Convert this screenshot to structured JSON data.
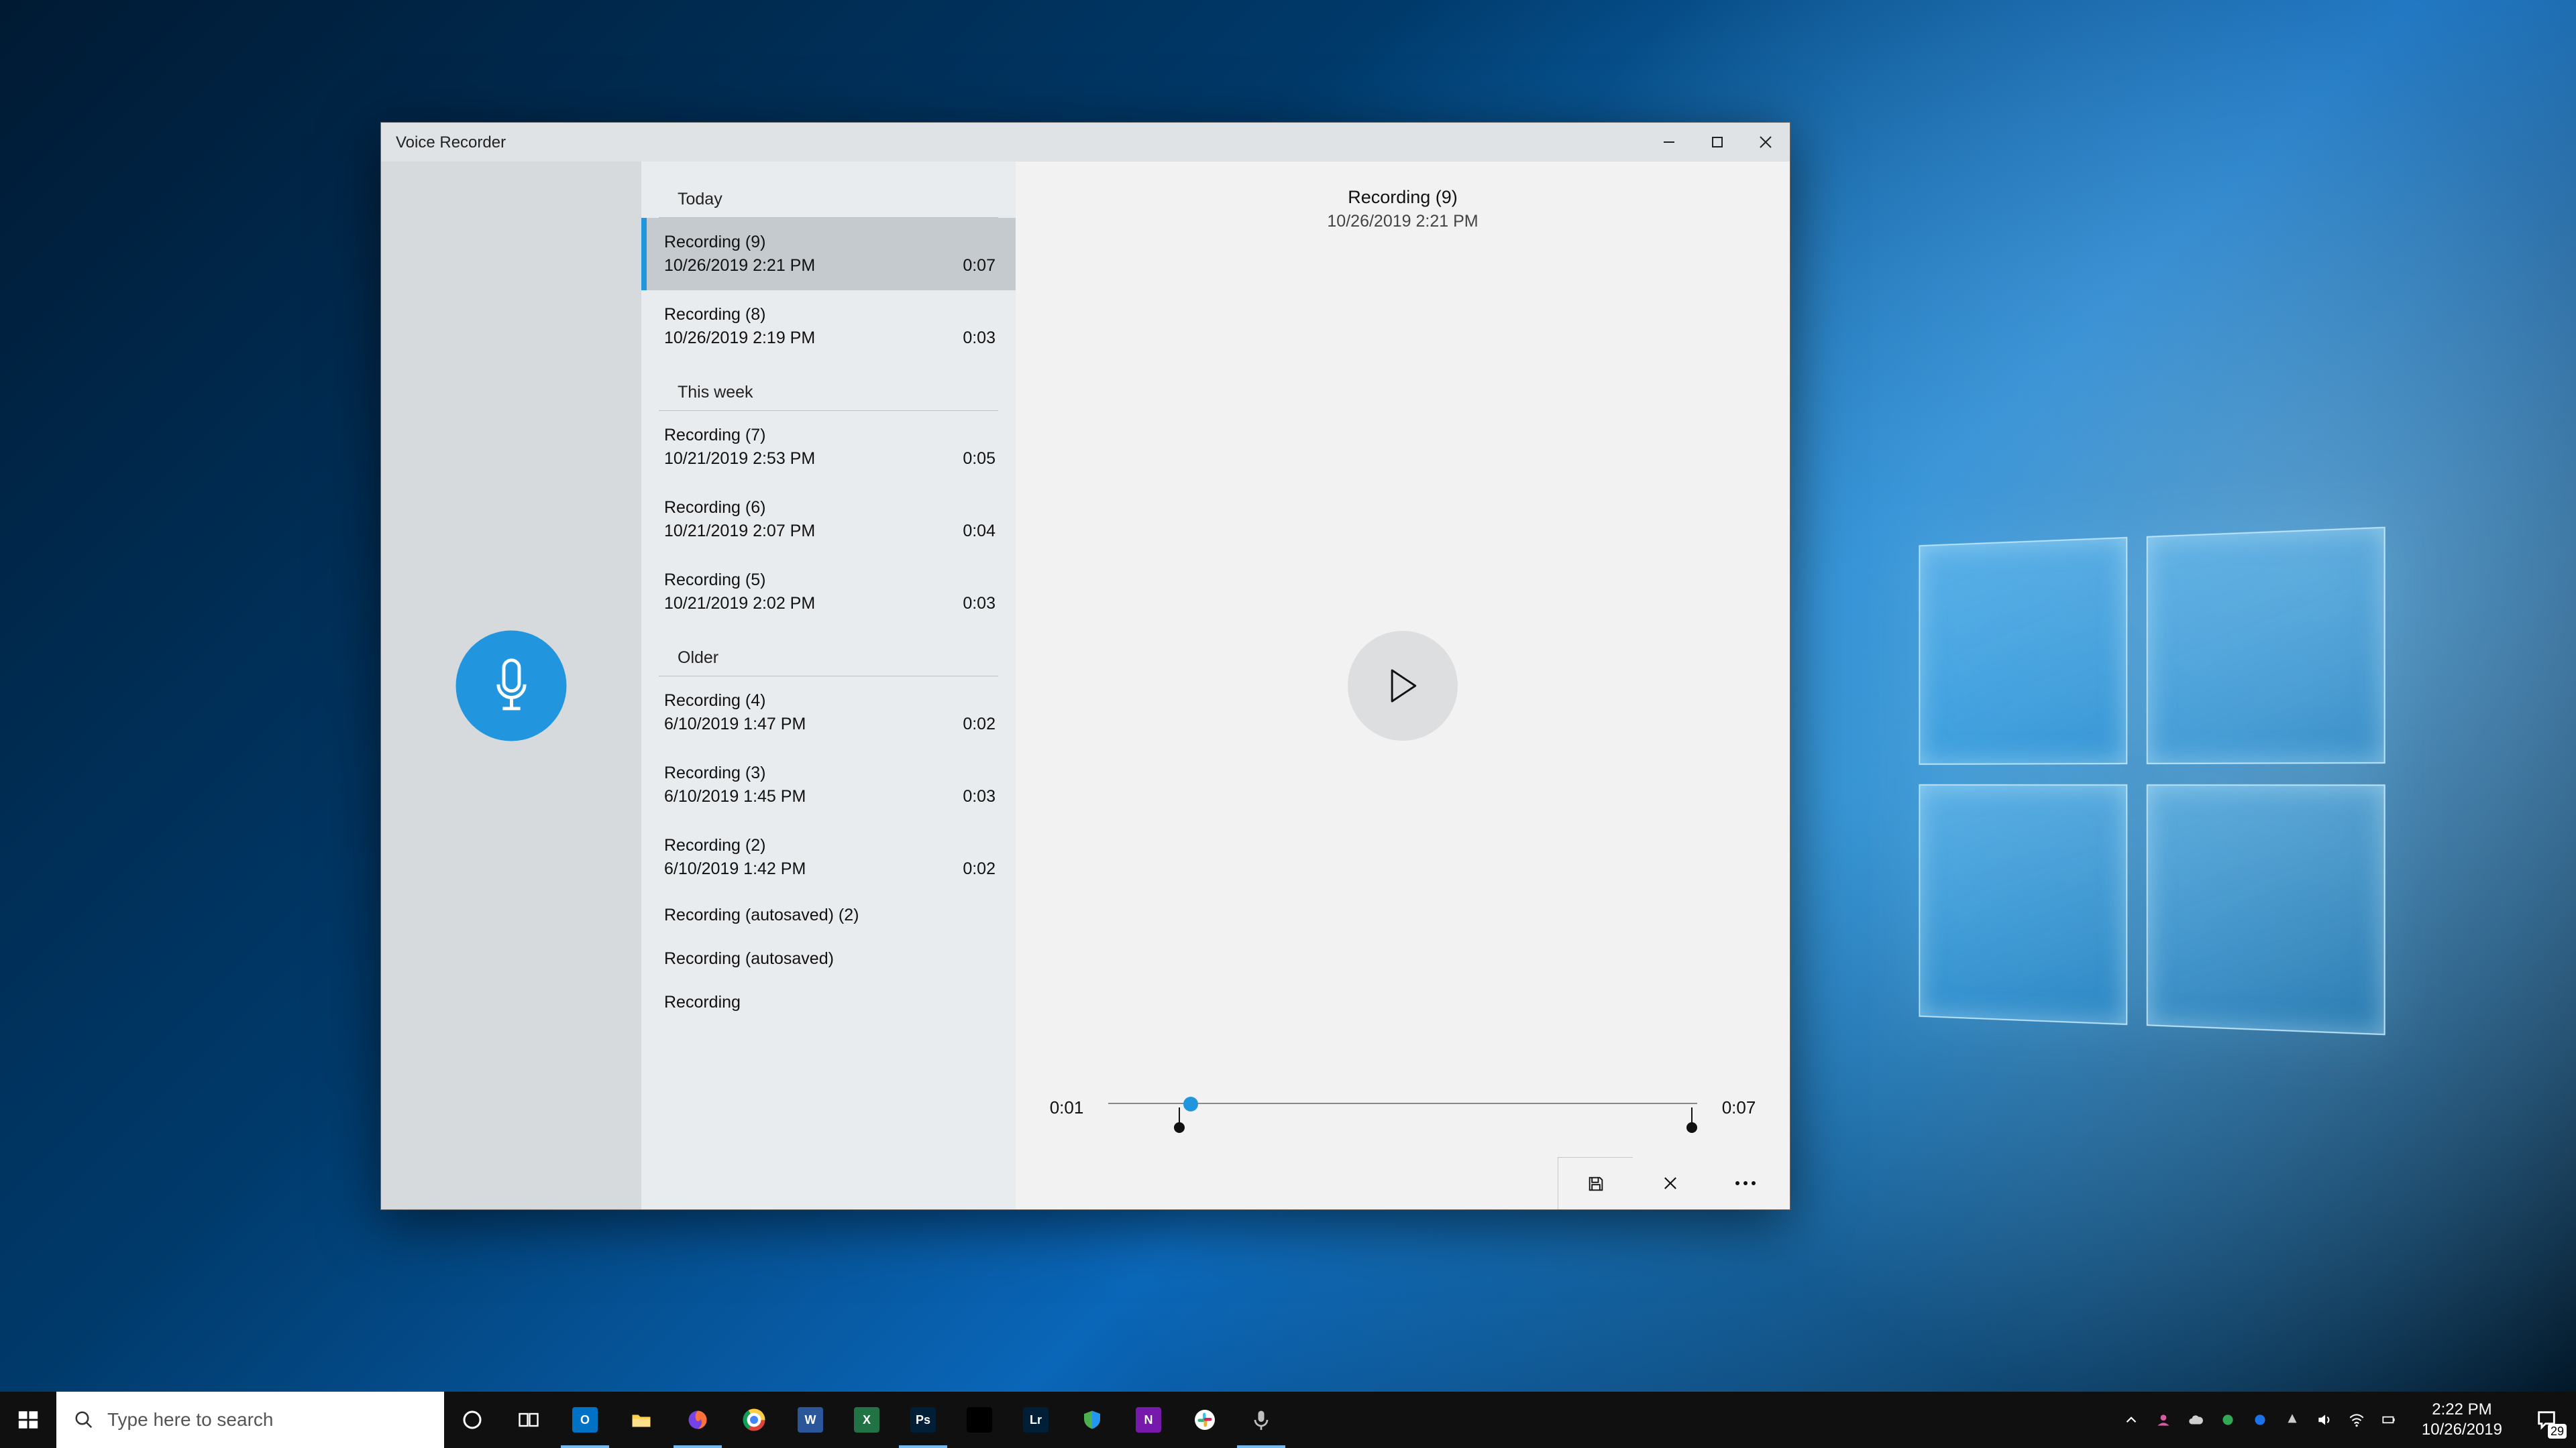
{
  "app": {
    "title": "Voice Recorder"
  },
  "recordings": {
    "groups": [
      {
        "label": "Today",
        "items": [
          {
            "name": "Recording (9)",
            "date": "10/26/2019 2:21 PM",
            "duration": "0:07",
            "selected": true
          },
          {
            "name": "Recording (8)",
            "date": "10/26/2019 2:19 PM",
            "duration": "0:03"
          }
        ]
      },
      {
        "label": "This week",
        "items": [
          {
            "name": "Recording (7)",
            "date": "10/21/2019 2:53 PM",
            "duration": "0:05"
          },
          {
            "name": "Recording (6)",
            "date": "10/21/2019 2:07 PM",
            "duration": "0:04"
          },
          {
            "name": "Recording (5)",
            "date": "10/21/2019 2:02 PM",
            "duration": "0:03"
          }
        ]
      },
      {
        "label": "Older",
        "items": [
          {
            "name": "Recording (4)",
            "date": "6/10/2019 1:47 PM",
            "duration": "0:02"
          },
          {
            "name": "Recording (3)",
            "date": "6/10/2019 1:45 PM",
            "duration": "0:03"
          },
          {
            "name": "Recording (2)",
            "date": "6/10/2019 1:42 PM",
            "duration": "0:02"
          },
          {
            "name": "Recording (autosaved) (2)"
          },
          {
            "name": "Recording (autosaved)"
          },
          {
            "name": "Recording"
          }
        ]
      }
    ]
  },
  "detail": {
    "title": "Recording (9)",
    "subtitle": "10/26/2019 2:21 PM",
    "current_time": "0:01",
    "total_time": "0:07",
    "playhead_pct": 14,
    "marker_start_pct": 12,
    "marker_end_pct": 99
  },
  "taskbar": {
    "search_placeholder": "Type here to search",
    "apps": [
      {
        "name": "cortana",
        "color": "transparent"
      },
      {
        "name": "task-view",
        "color": "transparent"
      },
      {
        "name": "outlook",
        "color": "#0072c6",
        "active": true,
        "letter": "O"
      },
      {
        "name": "file-explorer",
        "color": "#ffcf48",
        "letter": ""
      },
      {
        "name": "firefox",
        "color": "#ff7139",
        "active": true,
        "letter": ""
      },
      {
        "name": "chrome",
        "color": "#ffffff",
        "letter": ""
      },
      {
        "name": "word",
        "color": "#2b579a",
        "letter": "W"
      },
      {
        "name": "excel",
        "color": "#217346",
        "letter": "X"
      },
      {
        "name": "photoshop",
        "color": "#001e36",
        "active": true,
        "letter": "Ps"
      },
      {
        "name": "sonos",
        "color": "#000000",
        "letter": ""
      },
      {
        "name": "lightroom",
        "color": "#001e36",
        "letter": "Lr"
      },
      {
        "name": "defender",
        "color": "transparent",
        "letter": ""
      },
      {
        "name": "onenote",
        "color": "#7719aa",
        "letter": "N"
      },
      {
        "name": "slack",
        "color": "#ffffff",
        "letter": ""
      },
      {
        "name": "voice-recorder",
        "color": "#3b3b3b",
        "active": true,
        "letter": ""
      }
    ],
    "clock_time": "2:22 PM",
    "clock_date": "10/26/2019",
    "action_center_badge": "29"
  }
}
